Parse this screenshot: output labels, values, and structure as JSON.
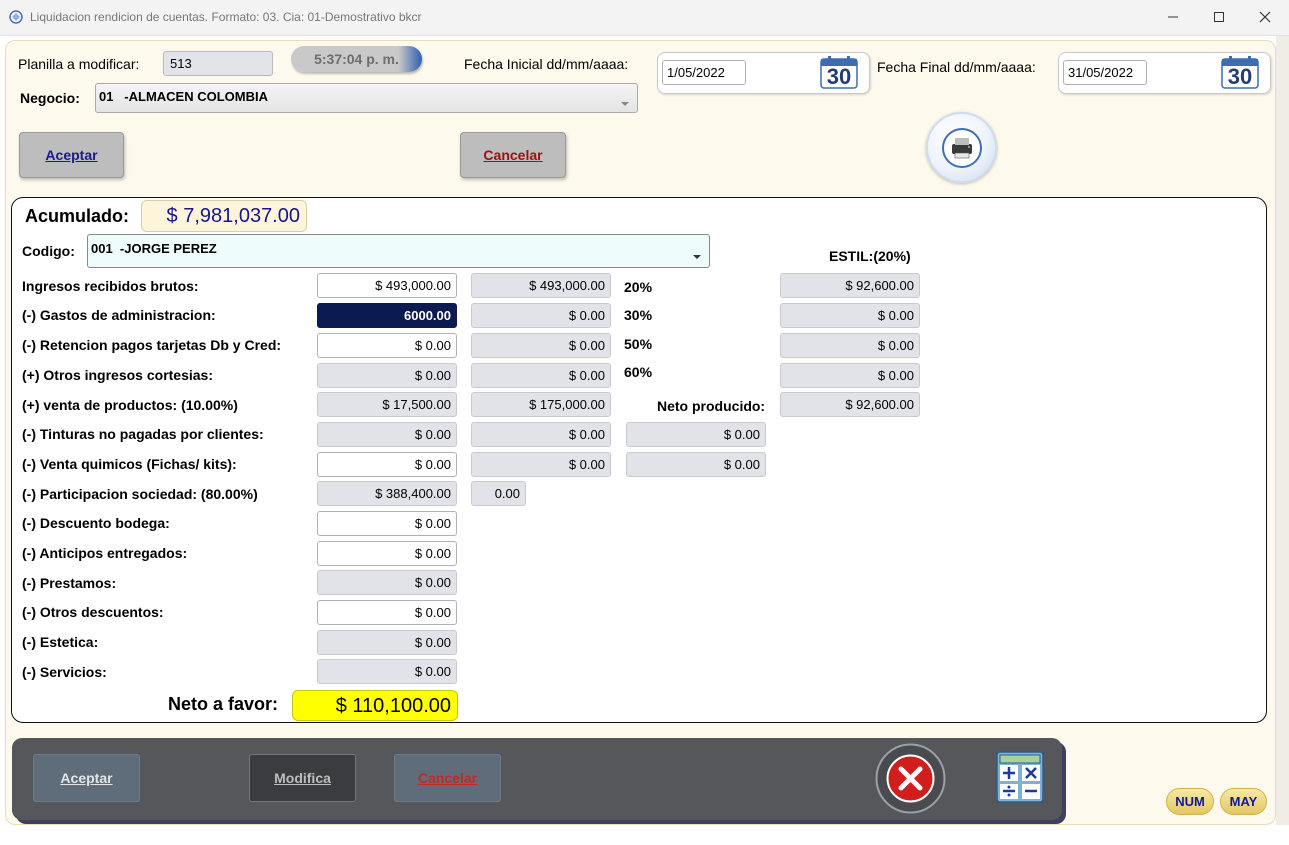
{
  "window": {
    "title": "Liquidacion rendicion de cuentas. Formato: 03. Cia: 01-Demostrativo bkcr",
    "minimize_icon": "minimize-icon",
    "maximize_icon": "maximize-icon",
    "close_icon": "close-icon"
  },
  "header": {
    "planilla_label": "Planilla a modificar:",
    "planilla_value": "513",
    "clock": "5:37:04 p. m.",
    "fecha_inicial_label": "Fecha Inicial dd/mm/aaaa:",
    "fecha_inicial_value": "1/05/2022",
    "fecha_final_label": "Fecha Final dd/mm/aaaa:",
    "fecha_final_value": "31/05/2022",
    "calendar_day": "30",
    "negocio_label": "Negocio:",
    "negocio_value": "01   -ALMACEN COLOMBIA",
    "aceptar": "Aceptar",
    "cancelar": "Cancelar",
    "print_icon": "printer-icon"
  },
  "card": {
    "acumulado_label": "Acumulado:",
    "acumulado_value": "$ 7,981,037.00",
    "codigo_label": "Codigo:",
    "codigo_value": "001  -JORGE PEREZ",
    "estil_label": "ESTIL:(20%)",
    "rows": [
      {
        "label": "Ingresos recibidos brutos:",
        "v1": "$ 493,000.00",
        "v2": "$ 493,000.00"
      },
      {
        "label": "(-) Gastos de administracion:",
        "v1": "6000.00",
        "v2": "$ 0.00"
      },
      {
        "label": "(-) Retencion pagos tarjetas Db y Cred:",
        "v1": "$ 0.00",
        "v2": "$ 0.00"
      },
      {
        "label": "(+) Otros ingresos cortesias:",
        "v1": "$ 0.00",
        "v2": "$ 0.00"
      },
      {
        "label": "(+) venta de productos: (10.00%)",
        "v1": "$ 17,500.00",
        "v2": "$ 175,000.00"
      },
      {
        "label": "(-) Tinturas no pagadas por clientes:",
        "v1": "$ 0.00",
        "v2": "$ 0.00",
        "v3": "$ 0.00"
      },
      {
        "label": "(-) Venta quimicos (Fichas/ kits):",
        "v1": "$ 0.00",
        "v2": "$ 0.00",
        "v3": "$ 0.00"
      },
      {
        "label": "(-) Participacion sociedad: (80.00%)",
        "v1": "$ 388,400.00",
        "v2": "0.00"
      },
      {
        "label": "(-) Descuento bodega:",
        "v1": "$ 0.00"
      },
      {
        "label": "(-) Anticipos entregados:",
        "v1": "$ 0.00"
      },
      {
        "label": "(-) Prestamos:",
        "v1": "$ 0.00"
      },
      {
        "label": "(-) Otros descuentos:",
        "v1": "$ 0.00"
      },
      {
        "label": "(-) Estetica:",
        "v1": "$ 0.00"
      },
      {
        "label": "(-) Servicios:",
        "v1": "$ 0.00"
      }
    ],
    "pct": [
      {
        "label": "20%",
        "value": "$ 92,600.00"
      },
      {
        "label": "30%",
        "value": "$ 0.00"
      },
      {
        "label": "50%",
        "value": "$ 0.00"
      },
      {
        "label": "60%",
        "value": "$ 0.00"
      }
    ],
    "neto_producido_label": "Neto producido:",
    "neto_producido_value": "$ 92,600.00",
    "neto_favor_label": "Neto a favor:",
    "neto_favor_value": "$ 110,100.00"
  },
  "bottom": {
    "aceptar": "Aceptar",
    "modifica": "Modifica",
    "cancelar": "Cancelar",
    "close_icon": "close-circle-icon",
    "calculator_icon": "calculator-icon",
    "num": "NUM",
    "may": "MAY"
  },
  "colors": {
    "selected_field": "#0c1a52",
    "neto_favor_bg": "#ffff00",
    "accent_blue": "#1c1c8a"
  }
}
